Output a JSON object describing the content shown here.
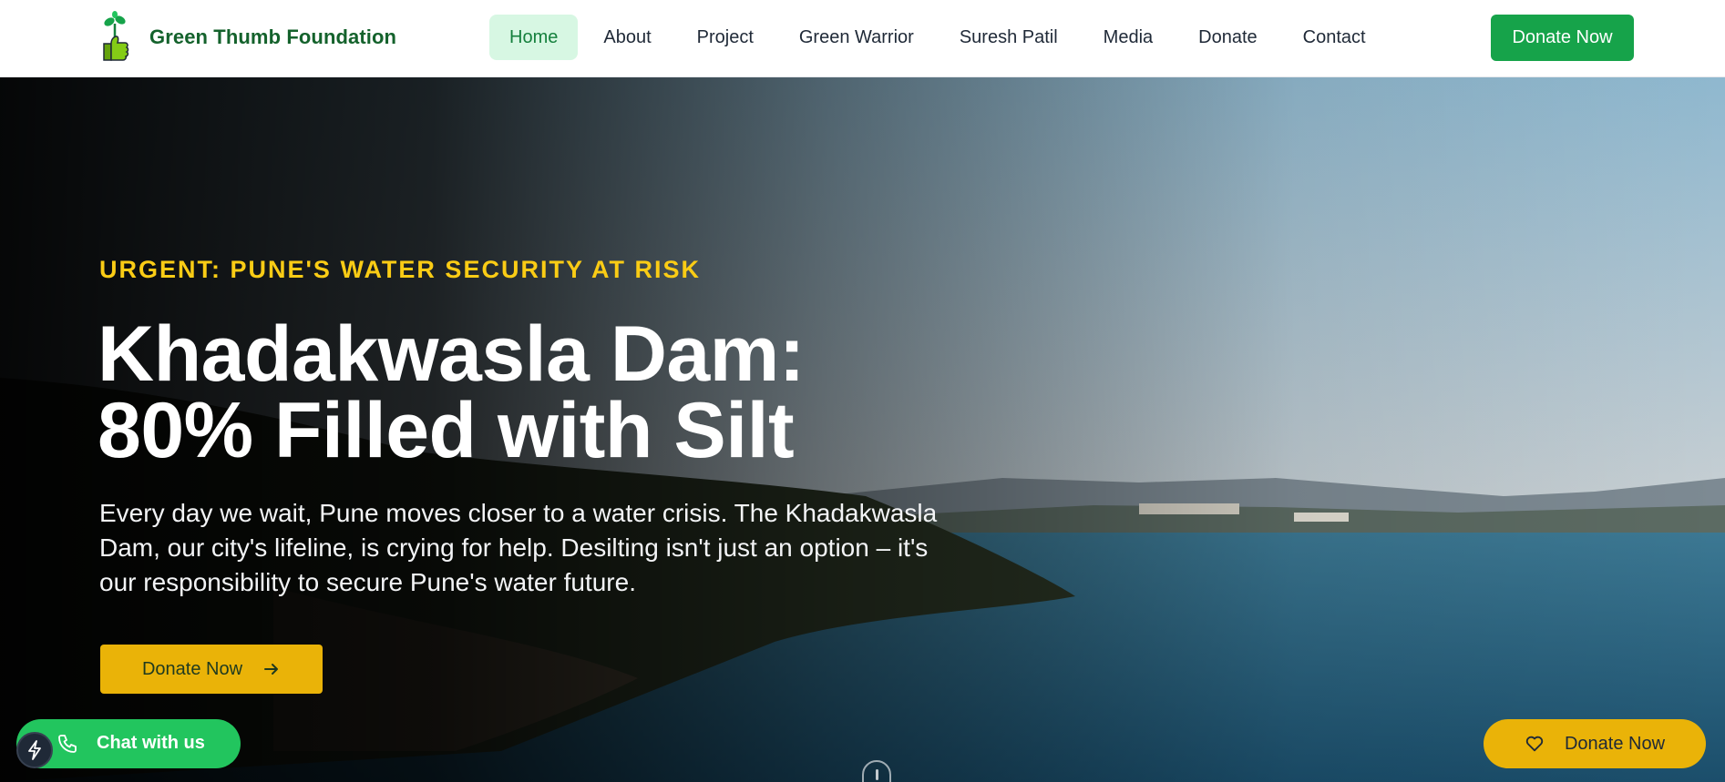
{
  "brand": {
    "name": "Green Thumb Foundation",
    "logo_icon": "thumbs-up-sprout-icon"
  },
  "nav": {
    "items": [
      {
        "label": "Home",
        "active": true
      },
      {
        "label": "About",
        "active": false
      },
      {
        "label": "Project",
        "active": false
      },
      {
        "label": "Green Warrior",
        "active": false
      },
      {
        "label": "Suresh Patil",
        "active": false
      },
      {
        "label": "Media",
        "active": false
      },
      {
        "label": "Donate",
        "active": false
      },
      {
        "label": "Contact",
        "active": false
      }
    ],
    "donate_label": "Donate Now"
  },
  "hero": {
    "kicker": "URGENT: PUNE'S WATER SECURITY AT RISK",
    "title_line1": "Khadakwasla Dam:",
    "title_line2": "80% Filled with Silt",
    "description": "Every day we wait, Pune moves closer to a water crisis. The Khadakwasla Dam, our city's lifeline, is crying for help. Desilting isn't just an option – it's our responsibility to secure Pune's water future.",
    "cta_label": "Donate Now",
    "cta_icon": "arrow-right-icon"
  },
  "floating": {
    "chat_label": "Chat with us",
    "chat_icon": "phone-icon",
    "bolt_icon": "lightning-bolt-icon",
    "donate_label": "Donate Now",
    "donate_icon": "heart-icon"
  },
  "colors": {
    "brand_green": "#14622c",
    "primary_green": "#16a34a",
    "active_nav_bg": "#d7f7e3",
    "accent_yellow": "#eab308",
    "kicker_yellow": "#facc15",
    "chat_green": "#22c55e"
  }
}
